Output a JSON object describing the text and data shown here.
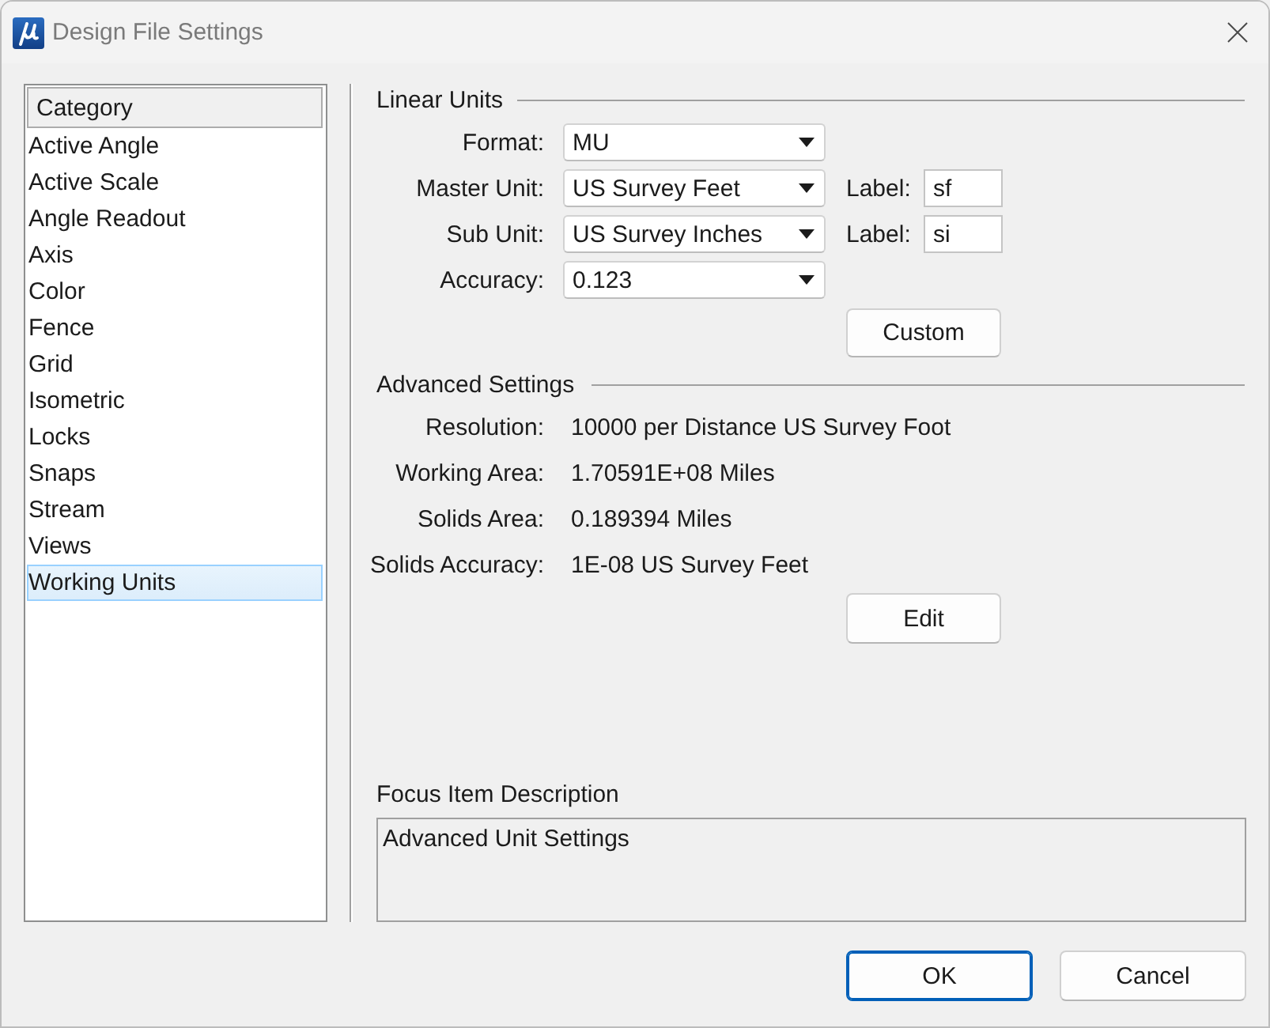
{
  "window": {
    "title": "Design File Settings"
  },
  "category_list": {
    "header": "Category",
    "items": [
      {
        "label": "Active Angle",
        "selected": false
      },
      {
        "label": "Active Scale",
        "selected": false
      },
      {
        "label": "Angle Readout",
        "selected": false
      },
      {
        "label": "Axis",
        "selected": false
      },
      {
        "label": "Color",
        "selected": false
      },
      {
        "label": "Fence",
        "selected": false
      },
      {
        "label": "Grid",
        "selected": false
      },
      {
        "label": "Isometric",
        "selected": false
      },
      {
        "label": "Locks",
        "selected": false
      },
      {
        "label": "Snaps",
        "selected": false
      },
      {
        "label": "Stream",
        "selected": false
      },
      {
        "label": "Views",
        "selected": false
      },
      {
        "label": "Working Units",
        "selected": true
      }
    ]
  },
  "linear_units": {
    "title": "Linear Units",
    "fields": [
      {
        "label": "Format:",
        "value": "MU"
      },
      {
        "label": "Master Unit:",
        "value": "US Survey Feet",
        "unit_label": {
          "label": "Label:",
          "value": "sf"
        }
      },
      {
        "label": "Sub Unit:",
        "value": "US Survey Inches",
        "unit_label": {
          "label": "Label:",
          "value": "si"
        }
      },
      {
        "label": "Accuracy:",
        "value": "0.123"
      }
    ],
    "button": "Custom"
  },
  "advanced_settings": {
    "title": "Advanced Settings",
    "rows": [
      {
        "label": "Resolution:",
        "value": "10000 per Distance US Survey Foot"
      },
      {
        "label": "Working Area:",
        "value": "1.70591E+08 Miles"
      },
      {
        "label": "Solids Area:",
        "value": "0.189394 Miles"
      },
      {
        "label": "Solids Accuracy:",
        "value": "1E-08 US Survey Feet"
      }
    ],
    "button": "Edit"
  },
  "focus_item_description": {
    "title": "Focus Item Description",
    "text": "Advanced Unit Settings"
  },
  "buttons": [
    {
      "label": "OK",
      "default": true
    },
    {
      "label": "Cancel",
      "default": false
    }
  ]
}
